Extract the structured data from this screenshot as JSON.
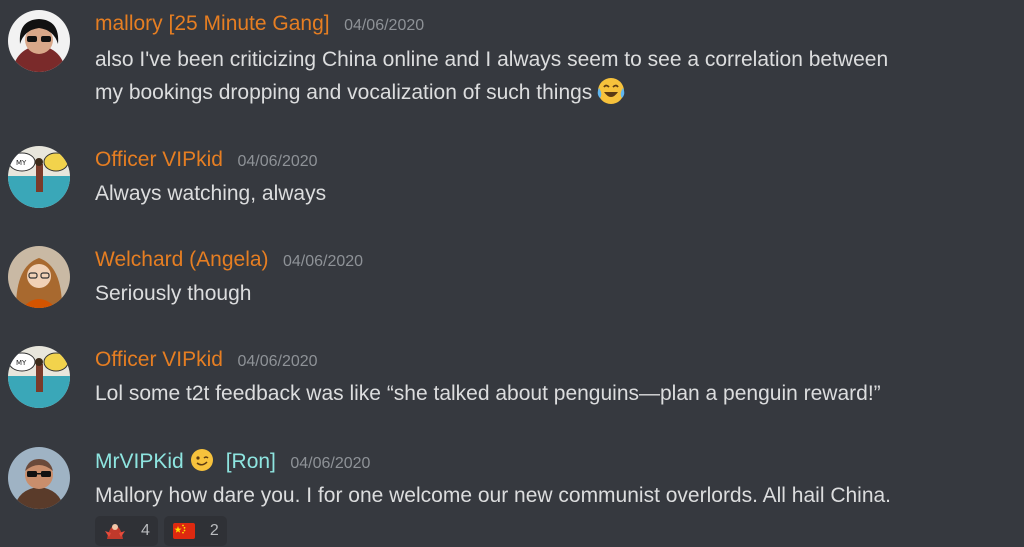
{
  "messages": [
    {
      "username": "mallory [25 Minute Gang]",
      "timestamp": "04/06/2020",
      "text_line1": "also I've been criticizing China online and I always seem to see a correlation between",
      "text_line2": "my bookings dropping and vocalization of such things",
      "inline_emoji": "joy-emoji"
    },
    {
      "username": "Officer VIPkid",
      "timestamp": "04/06/2020",
      "text": "Always watching, always"
    },
    {
      "username": "Welchard (Angela)",
      "timestamp": "04/06/2020",
      "text": "Seriously though"
    },
    {
      "username": "Officer VIPkid",
      "timestamp": "04/06/2020",
      "text": "Lol some t2t feedback was like “she talked about penguins—plan a penguin reward!”"
    },
    {
      "username": "MrVIPKid",
      "username_emoji": "wink-emoji",
      "role": "[Ron]",
      "timestamp": "04/06/2020",
      "text": "Mallory how dare you. I for one welcome our new communist overlords. All hail China.",
      "reactions": [
        {
          "emoji": "custom-figure-emoji",
          "count": "4"
        },
        {
          "emoji": "china-flag-emoji",
          "count": "2"
        }
      ]
    }
  ],
  "colors": {
    "background": "#36393f",
    "username_orange": "#e67e22",
    "username_teal": "#8ee5e0",
    "text": "#dcddde",
    "timestamp": "#8e9297",
    "reaction_bg": "#2f3136"
  }
}
